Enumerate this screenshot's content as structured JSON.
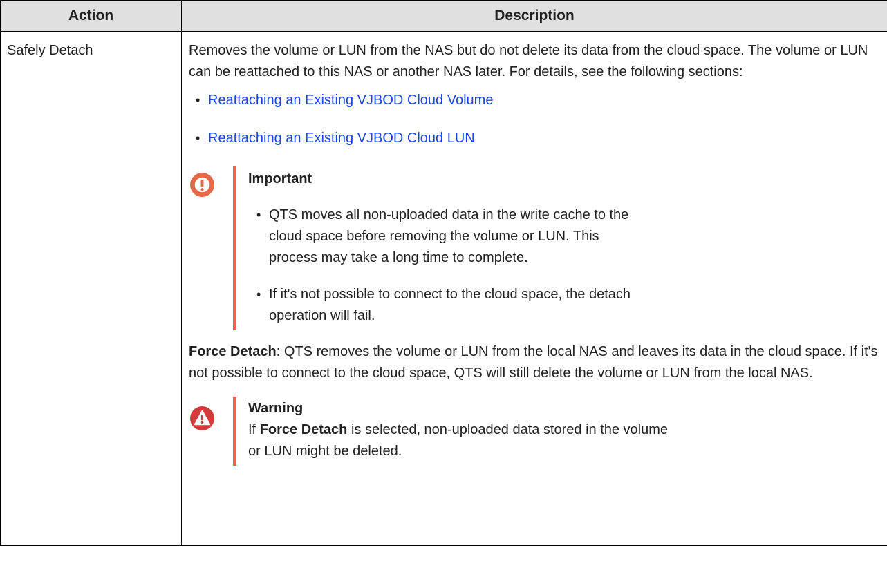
{
  "table": {
    "headers": {
      "action": "Action",
      "description": "Description"
    },
    "row": {
      "action": "Safely Detach",
      "intro": "Removes the volume or LUN from the NAS but do not delete its data from the cloud space. The volume or LUN can be reattached to this NAS or another NAS later. For details, see the following sections:",
      "links": [
        "Reattaching an Existing VJBOD Cloud Volume",
        "Reattaching an Existing VJBOD Cloud LUN"
      ],
      "important": {
        "title": "Important",
        "items": [
          "QTS moves all non-uploaded data in the write cache to the cloud space before removing the volume or LUN. This process may take a long time to complete.",
          "If it's not possible to connect to the cloud space, the detach operation will fail."
        ]
      },
      "force_detach": {
        "term": "Force Detach",
        "text": ": QTS removes the volume or LUN from the local NAS and leaves its data in the cloud space. If it's not possible to connect to the cloud space, QTS will still delete the volume or LUN from the local NAS."
      },
      "warning": {
        "title": "Warning",
        "prefix": "If ",
        "term": "Force Detach",
        "suffix": " is selected, non-uploaded data stored in the volume or LUN might be deleted."
      }
    }
  },
  "colors": {
    "link": "#1a45e8",
    "accent_bar": "#e8694a",
    "important_icon": "#e8694a",
    "warning_icon": "#d43b3b",
    "header_bg": "#e0e0e0"
  },
  "icons": {
    "important": "exclamation-circle-icon",
    "warning": "warning-triangle-icon",
    "bullet": "bullet-dot"
  }
}
